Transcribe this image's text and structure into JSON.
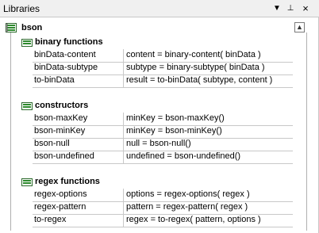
{
  "window": {
    "title": "Libraries",
    "buttons": {
      "dropdown": "▼",
      "pin": "⊥",
      "close": "×"
    }
  },
  "tree": {
    "root": {
      "label": "bson",
      "collapse_glyph": "▲"
    },
    "groups": [
      {
        "label": "binary functions",
        "rows": [
          {
            "name": "binData-content",
            "signature": "content = binary-content( binData )"
          },
          {
            "name": "binData-subtype",
            "signature": "subtype = binary-subtype( binData )"
          },
          {
            "name": "to-binData",
            "signature": "result = to-binData( subtype, content )"
          }
        ]
      },
      {
        "label": "constructors",
        "rows": [
          {
            "name": "bson-maxKey",
            "signature": "minKey = bson-maxKey()"
          },
          {
            "name": "bson-minKey",
            "signature": "minKey = bson-minKey()"
          },
          {
            "name": "bson-null",
            "signature": "null = bson-null()"
          },
          {
            "name": "bson-undefined",
            "signature": "undefined = bson-undefined()"
          }
        ]
      },
      {
        "label": "regex functions",
        "rows": [
          {
            "name": "regex-options",
            "signature": "options = regex-options( regex )"
          },
          {
            "name": "regex-pattern",
            "signature": "pattern = regex-pattern( regex )"
          },
          {
            "name": "to-regex",
            "signature": "regex = to-regex( pattern, options )"
          }
        ]
      }
    ]
  }
}
